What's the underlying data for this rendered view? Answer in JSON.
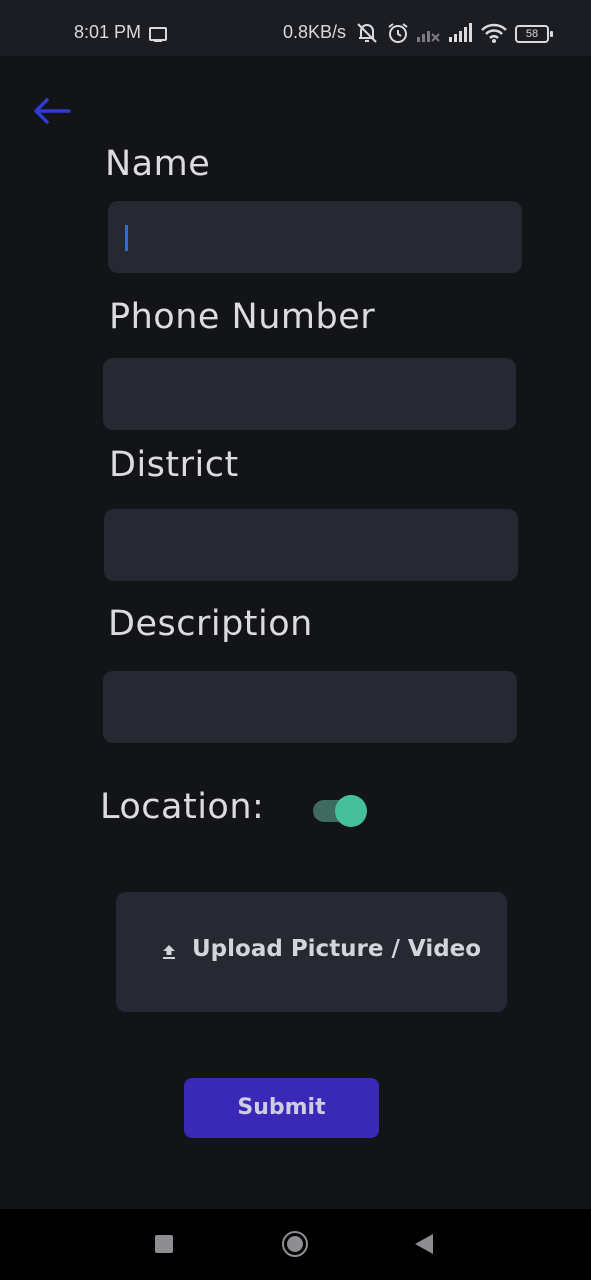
{
  "status_bar": {
    "time": "8:01 PM",
    "net_speed": "0.8KB/s",
    "battery": "58",
    "icons": [
      "screen-cast-icon",
      "mute-icon",
      "alarm-icon",
      "signal-no-sim-icon",
      "signal-icon",
      "wifi-icon",
      "battery-icon"
    ]
  },
  "form": {
    "name_label": "Name",
    "name_value": "",
    "phone_label": "Phone Number",
    "phone_value": "",
    "district_label": "District",
    "district_value": "",
    "description_label": "Description",
    "description_value": "",
    "location_label": "Location:",
    "location_enabled": true,
    "upload_label": "Upload Picture / Video",
    "submit_label": "Submit"
  },
  "colors": {
    "background": "#131418",
    "field": "#262931",
    "accent_back_arrow": "#2f3bd0",
    "toggle_on": "#45c09a",
    "submit": "#3a28b6"
  },
  "nav_bar": {
    "icons": [
      "recents-icon",
      "home-icon",
      "back-icon"
    ]
  }
}
